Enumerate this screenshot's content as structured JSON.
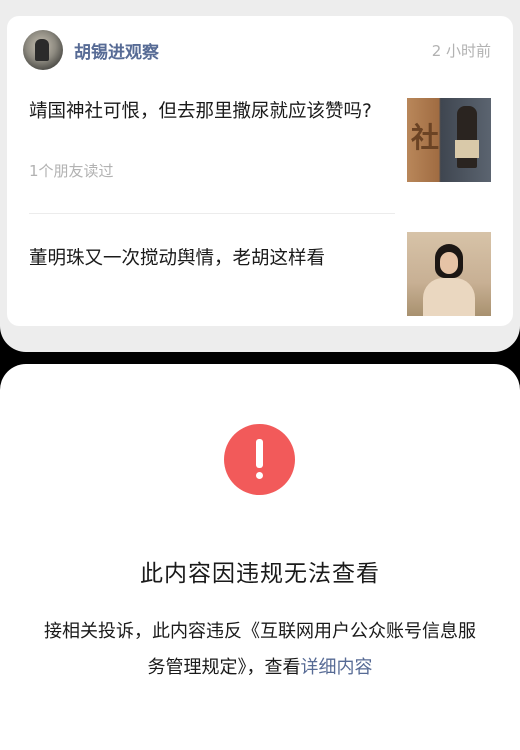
{
  "account": {
    "name": "胡锡进观察",
    "time": "2 小时前"
  },
  "articles": [
    {
      "title": "靖国神社可恨，但去那里撒尿就应该赞吗?",
      "meta": "1个朋友读过",
      "thumbnail_text": "社"
    },
    {
      "title": "董明珠又一次搅动舆情，老胡这样看",
      "meta": ""
    }
  ],
  "notice": {
    "title": "此内容因违规无法查看",
    "body": "接相关投诉，此内容违反《互联网用户公众账号信息服务管理规定》，查看",
    "link": "详细内容"
  },
  "colors": {
    "link_blue": "#576b95",
    "warning_red": "#f25a5a",
    "muted_gray": "#b2b2b2"
  }
}
